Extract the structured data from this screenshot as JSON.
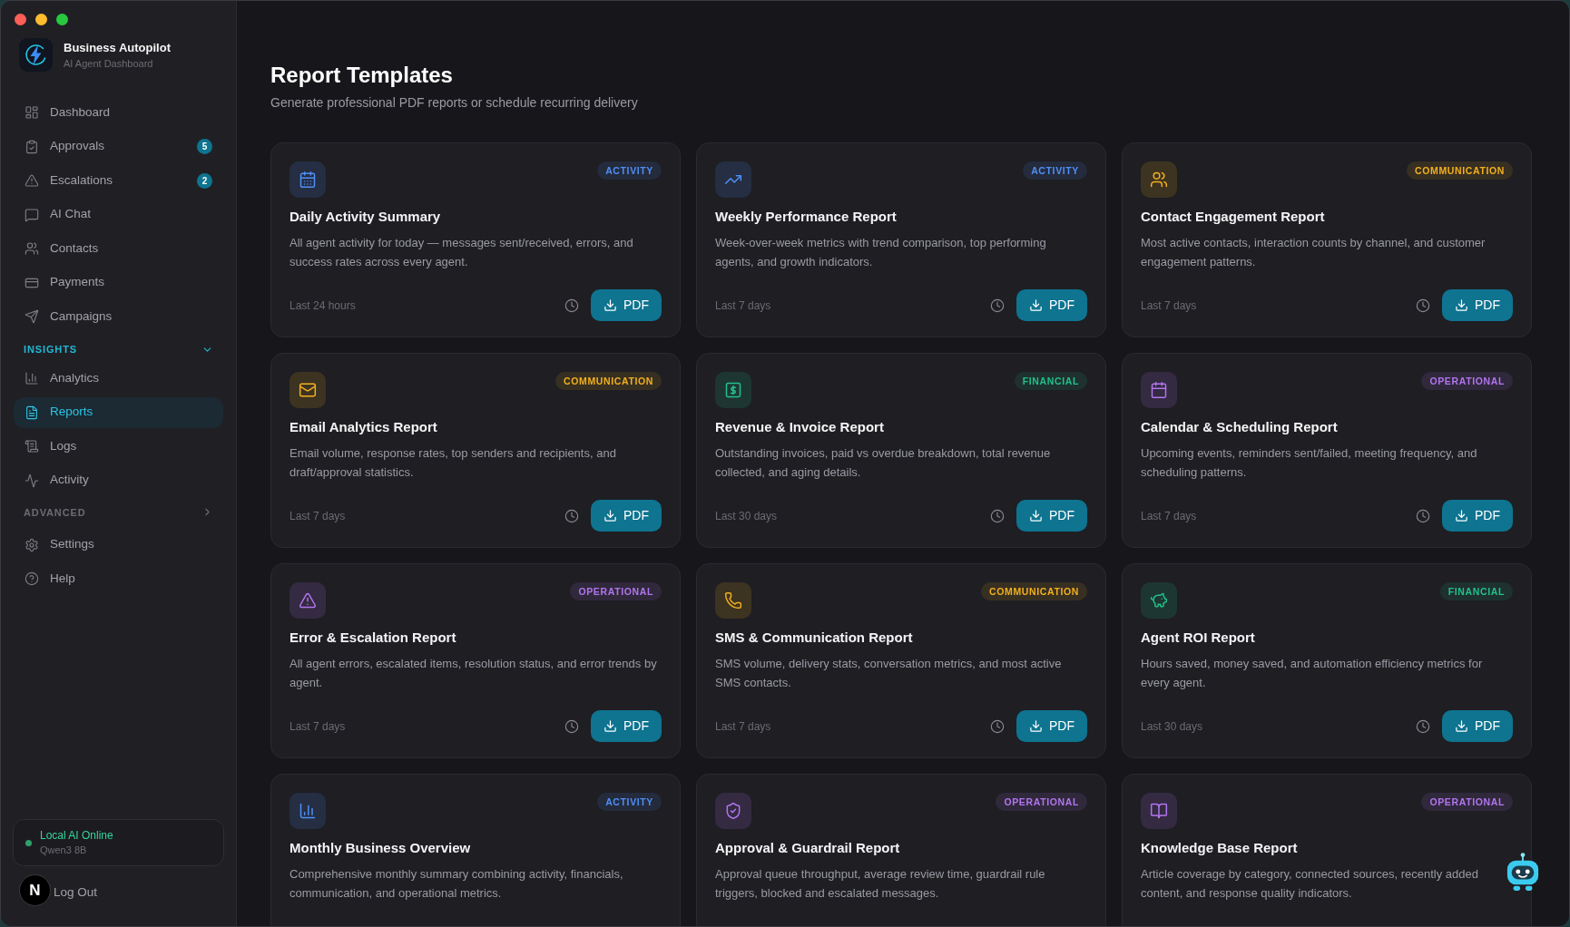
{
  "sidebar": {
    "brand": {
      "title": "Business Autopilot",
      "subtitle": "AI Agent Dashboard"
    },
    "sections": [
      {
        "items": [
          {
            "label": "Dashboard",
            "selected": false
          },
          {
            "label": "Approvals",
            "selected": false,
            "badge": "5"
          },
          {
            "label": "Escalations",
            "selected": false,
            "badge": "2"
          },
          {
            "label": "AI Chat",
            "selected": false
          },
          {
            "label": "Contacts",
            "selected": false
          },
          {
            "label": "Payments",
            "selected": false
          },
          {
            "label": "Campaigns",
            "selected": false
          }
        ]
      },
      {
        "title": "INSIGHTS",
        "expanded": true,
        "items": [
          {
            "label": "Analytics",
            "selected": false
          },
          {
            "label": "Reports",
            "selected": true
          },
          {
            "label": "Logs",
            "selected": false
          },
          {
            "label": "Activity",
            "selected": false
          }
        ]
      },
      {
        "title": "ADVANCED",
        "expanded": false
      }
    ],
    "footer_items": [
      {
        "label": "Settings",
        "selected": false
      },
      {
        "label": "Help",
        "selected": false
      }
    ],
    "status": {
      "title": "Local AI Online",
      "subtitle": "Qwen3 8B",
      "online": true
    },
    "logout": {
      "label": "Log Out"
    }
  },
  "main": {
    "title": "Report Templates",
    "subtitle": "Generate professional PDF reports or schedule recurring delivery",
    "templates": [
      {
        "title": "Daily Activity Summary",
        "category": "ACTIVITY",
        "color": "#4f8ff7",
        "description": "All agent activity for today — messages sent/received, errors, and success rates across every agent.",
        "period": "Last 24 hours",
        "action": "PDF"
      },
      {
        "title": "Weekly Performance Report",
        "category": "ACTIVITY",
        "color": "#4f8ff7",
        "description": "Week-over-week metrics with trend comparison, top performing agents, and growth indicators.",
        "period": "Last 7 days",
        "action": "PDF"
      },
      {
        "title": "Contact Engagement Report",
        "category": "COMMUNICATION",
        "color": "#f2b01e",
        "description": "Most active contacts, interaction counts by channel, and customer engagement patterns.",
        "period": "Last 7 days",
        "action": "PDF"
      },
      {
        "title": "Email Analytics Report",
        "category": "COMMUNICATION",
        "color": "#f2b01e",
        "description": "Email volume, response rates, top senders and recipients, and draft/approval statistics.",
        "period": "Last 7 days",
        "action": "PDF"
      },
      {
        "title": "Revenue & Invoice Report",
        "category": "FINANCIAL",
        "color": "#22c08a",
        "description": "Outstanding invoices, paid vs overdue breakdown, total revenue collected, and aging details.",
        "period": "Last 30 days",
        "action": "PDF"
      },
      {
        "title": "Calendar & Scheduling Report",
        "category": "OPERATIONAL",
        "color": "#b275f0",
        "description": "Upcoming events, reminders sent/failed, meeting frequency, and scheduling patterns.",
        "period": "Last 7 days",
        "action": "PDF"
      },
      {
        "title": "Error & Escalation Report",
        "category": "OPERATIONAL",
        "color": "#b275f0",
        "description": "All agent errors, escalated items, resolution status, and error trends by agent.",
        "period": "Last 7 days",
        "action": "PDF"
      },
      {
        "title": "SMS & Communication Report",
        "category": "COMMUNICATION",
        "color": "#f2b01e",
        "description": "SMS volume, delivery stats, conversation metrics, and most active SMS contacts.",
        "period": "Last 7 days",
        "action": "PDF"
      },
      {
        "title": "Agent ROI Report",
        "category": "FINANCIAL",
        "color": "#22c08a",
        "description": "Hours saved, money saved, and automation efficiency metrics for every agent.",
        "period": "Last 30 days",
        "action": "PDF"
      },
      {
        "title": "Monthly Business Overview",
        "category": "ACTIVITY",
        "color": "#4f8ff7",
        "description": "Comprehensive monthly summary combining activity, financials, communication, and operational metrics."
      },
      {
        "title": "Approval & Guardrail Report",
        "category": "OPERATIONAL",
        "color": "#b275f0",
        "description": "Approval queue throughput, average review time, guardrail rule triggers, blocked and escalated messages."
      },
      {
        "title": "Knowledge Base Report",
        "category": "OPERATIONAL",
        "color": "#b275f0",
        "description": "Article coverage by category, connected sources, recently added content, and response quality indicators."
      }
    ]
  },
  "dev_indicator": {
    "label": "N"
  }
}
